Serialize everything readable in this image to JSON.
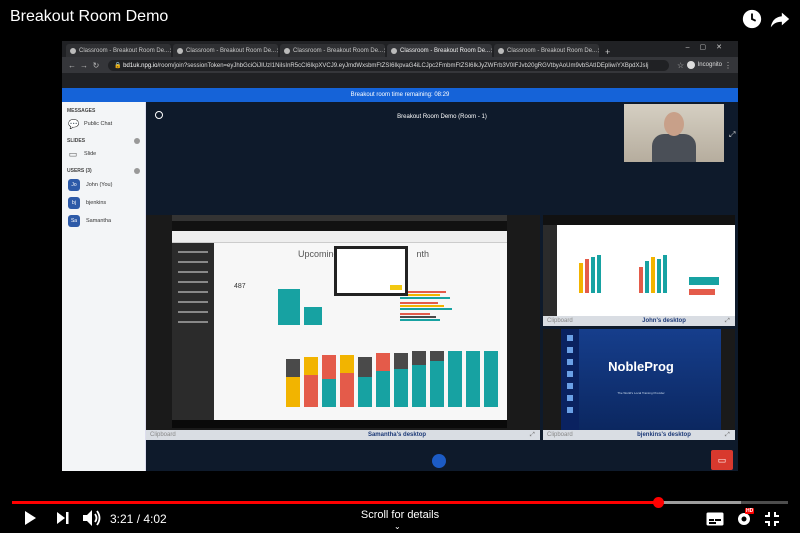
{
  "video": {
    "title": "Breakout Room Demo",
    "current_time": "3:21",
    "duration": "4:02",
    "progress": 0.832,
    "buffered": 0.94,
    "scroll_hint": "Scroll for details",
    "hd_badge": "HD"
  },
  "browser": {
    "tabs": [
      {
        "label": "Classroom - Breakout Room De...",
        "active": false
      },
      {
        "label": "Classroom - Breakout Room De...",
        "active": false
      },
      {
        "label": "Classroom - Breakout Room De...",
        "active": false
      },
      {
        "label": "Classroom - Breakout Room De...",
        "active": true
      },
      {
        "label": "Classroom - Breakout Room De...",
        "active": false
      }
    ],
    "url_host": "bd1uk.npg.io",
    "url_path": "/room/join?sessionToken=eyJhbGciOiJIUzI1NiIsInR5cCI6IkpXVCJ9.eyJmdWxsbmFtZSI6IkpvaG4iLCJpc2FmbmFtZSI6IkJyZWFrb3V0IFJvb20gRGVtbyAoUm9vbSAtIDEpIiwiYXBpdXJsIj",
    "incognito_label": "Incognito"
  },
  "room": {
    "timer_banner": "Breakout room time remaining: 08:29",
    "title": "Breakout Room Demo (Room - 1)"
  },
  "sidebar": {
    "messages_header": "MESSAGES",
    "public_chat": "Public Chat",
    "slides_header": "SLIDES",
    "slide_item": "Slide",
    "users_header": "USERS (3)",
    "users": [
      {
        "initials": "Jo",
        "name": "John (You)"
      },
      {
        "initials": "bj",
        "name": "bjenkins"
      },
      {
        "initials": "Sa",
        "name": "Samantha"
      }
    ]
  },
  "tiles": {
    "clipboard_label": "Clipboard",
    "samantha": "Samantha's desktop",
    "john": "John's desktop",
    "bjenkins": "bjenkins's desktop"
  },
  "shared_screen": {
    "report_heading": "Upcoming",
    "report_heading_tail": "nth",
    "kpi": "487"
  },
  "bj_screen": {
    "logo": "NobleProg",
    "tagline": "The World's Local Training Provider"
  }
}
